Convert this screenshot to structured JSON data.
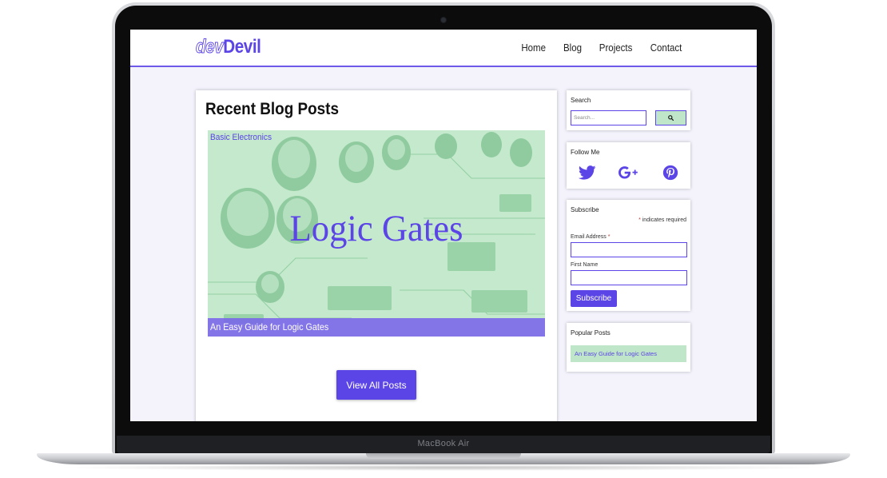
{
  "device": {
    "model_label": "MacBook Air"
  },
  "site": {
    "logo": {
      "part1": "dev",
      "part2": "Devil"
    },
    "nav": [
      "Home",
      "Blog",
      "Projects",
      "Contact"
    ]
  },
  "main": {
    "title": "Recent Blog Posts",
    "post": {
      "category": "Basic Electronics",
      "image_text": "Logic Gates",
      "title": "An Easy Guide for Logic Gates"
    },
    "view_all_label": "View All Posts"
  },
  "sidebar": {
    "search": {
      "title": "Search",
      "placeholder": "Search..."
    },
    "follow": {
      "title": "Follow Me",
      "icons": [
        "twitter-icon",
        "google-plus-icon",
        "pinterest-icon"
      ]
    },
    "subscribe": {
      "title": "Subscribe",
      "required_star": "*",
      "required_text": " indicates required",
      "email_label": "Email Address ",
      "email_star": "*",
      "first_name_label": "First Name",
      "button_label": "Subscribe"
    },
    "popular": {
      "title": "Popular Posts",
      "items": [
        "An Easy Guide for Logic Gates"
      ]
    }
  },
  "colors": {
    "accent": "#5b45e6",
    "mint": "#bfe6c8",
    "page_bg": "#f4f3fc"
  }
}
